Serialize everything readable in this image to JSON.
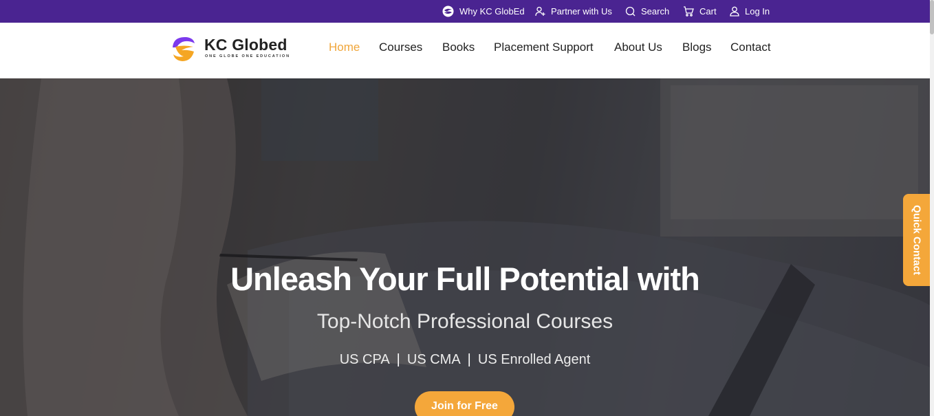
{
  "colors": {
    "topbar_bg": "#4a2491",
    "accent": "#f4a73a",
    "nav_active": "#f0a63b",
    "logo_purple": "#7c3aed",
    "logo_orange": "#f5a623"
  },
  "topbar": {
    "items": [
      {
        "label": "Why KC GlobEd",
        "icon": "globed-logo-icon"
      },
      {
        "label": "Partner with Us",
        "icon": "user-plus-icon"
      },
      {
        "label": "Search",
        "icon": "search-icon"
      },
      {
        "label": "Cart",
        "icon": "cart-icon"
      },
      {
        "label": "Log In",
        "icon": "user-icon"
      }
    ]
  },
  "logo": {
    "name": "KC Globed",
    "tagline": "ONE GLOBE ONE EDUCATION"
  },
  "nav": {
    "items": [
      {
        "label": "Home",
        "active": true
      },
      {
        "label": "Courses",
        "active": false
      },
      {
        "label": "Books",
        "active": false
      },
      {
        "label": "Placement Support",
        "active": false
      },
      {
        "label": "About Us",
        "active": false
      },
      {
        "label": "Blogs",
        "active": false
      },
      {
        "label": "Contact",
        "active": false
      }
    ]
  },
  "hero": {
    "title": "Unleash Your Full Potential with",
    "subtitle": "Top-Notch Professional Courses",
    "programs": [
      "US CPA",
      "US CMA",
      "US Enrolled Agent"
    ],
    "separator": "|",
    "cta_label": "Join for Free"
  },
  "quick_contact": {
    "label": "Quick Contact"
  }
}
